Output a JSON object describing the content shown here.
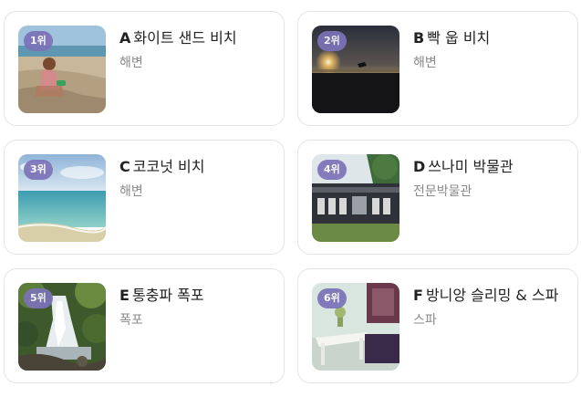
{
  "cards": [
    {
      "rank": "1위",
      "letter": "A",
      "name": "화이트 샌드 비치",
      "category": "해변",
      "image": "beach-with-child-photo"
    },
    {
      "rank": "2위",
      "letter": "B",
      "name": "빡 웁 비치",
      "category": "해변",
      "image": "sunset-beach-photo"
    },
    {
      "rank": "3위",
      "letter": "C",
      "name": "코코넛 비치",
      "category": "해변",
      "image": "turquoise-sea-photo"
    },
    {
      "rank": "4위",
      "letter": "D",
      "name": "쓰나미 박물관",
      "category": "전문박물관",
      "image": "museum-building-photo"
    },
    {
      "rank": "5위",
      "letter": "E",
      "name": "통충파 폭포",
      "category": "폭포",
      "image": "waterfall-photo"
    },
    {
      "rank": "6위",
      "letter": "F",
      "name": "방니앙 슬리밍 & 스파",
      "category": "스파",
      "image": "spa-room-photo"
    }
  ],
  "badge_color": "#7b72b8"
}
